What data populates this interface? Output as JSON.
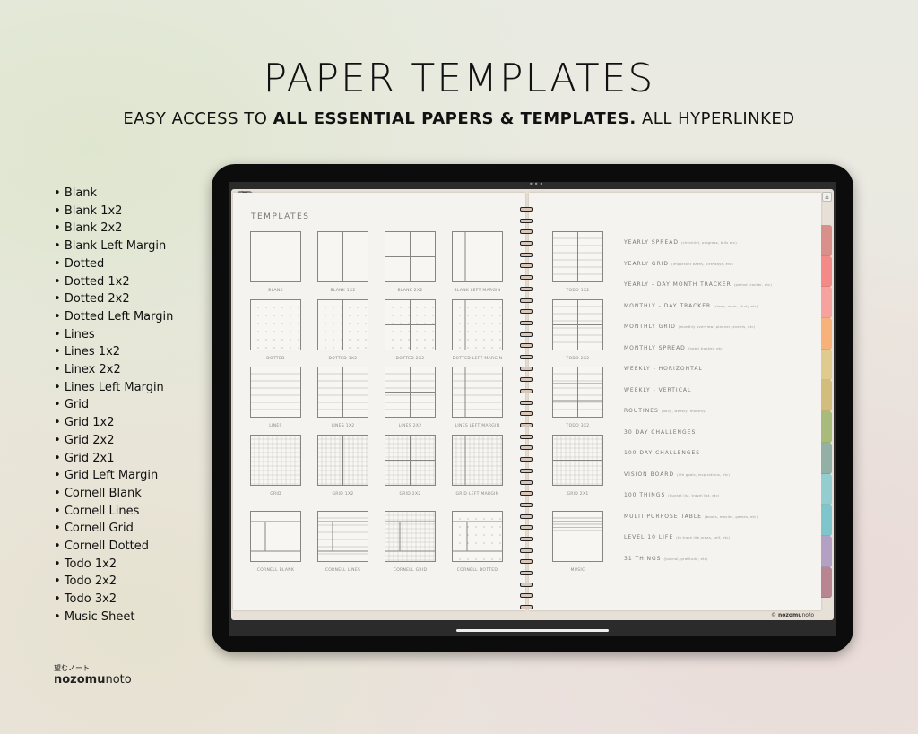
{
  "header": {
    "title": "PAPER TEMPLATES",
    "subtitle_pre": "EASY ACCESS TO ",
    "subtitle_bold": "ALL ESSENTIAL PAPERS & TEMPLATES.",
    "subtitle_post": " ALL HYPERLINKED"
  },
  "bullets": [
    "Blank",
    "Blank 1x2",
    "Blank 2x2",
    "Blank Left Margin",
    "Dotted",
    "Dotted 1x2",
    "Dotted 2x2",
    "Dotted Left Margin",
    "Lines",
    "Lines 1x2",
    "Linex 2x2",
    "Lines Left Margin",
    "Grid",
    "Grid 1x2",
    "Grid 2x2",
    "Grid 2x1",
    "Grid Left Margin",
    "Cornell Blank",
    "Cornell Lines",
    "Cornell Grid",
    "Cornell Dotted",
    "Todo 1x2",
    "Todo 2x2",
    "Todo 3x2",
    "Music Sheet"
  ],
  "brand": {
    "jp": "望むノート",
    "bold": "nozomu",
    "rest": "noto"
  },
  "notebook": {
    "collapse_icon": "chevron-down-icon",
    "menu_icon": "more-dots-icon",
    "home_icon": "home-icon",
    "page_title": "TEMPLATES",
    "copyright_pre": "© ",
    "copyright_bold": "nozomu",
    "copyright_rest": "noto",
    "left_templates": [
      {
        "label": "BLANK",
        "fill": "blank",
        "split": "none"
      },
      {
        "label": "BLANK 1X2",
        "fill": "blank",
        "split": "1x2"
      },
      {
        "label": "BLANK 2X2",
        "fill": "blank",
        "split": "2x2"
      },
      {
        "label": "BLANK LEFT MARGIN",
        "fill": "blank",
        "split": "margin"
      },
      {
        "label": "DOTTED",
        "fill": "dots",
        "split": "none"
      },
      {
        "label": "DOTTED 1X2",
        "fill": "dots",
        "split": "1x2"
      },
      {
        "label": "DOTTED 2X2",
        "fill": "dots",
        "split": "2x2"
      },
      {
        "label": "DOTTED LEFT MARGIN",
        "fill": "dots",
        "split": "margin"
      },
      {
        "label": "LINES",
        "fill": "lines",
        "split": "none"
      },
      {
        "label": "LINES 1X2",
        "fill": "lines",
        "split": "1x2"
      },
      {
        "label": "LINES 2X2",
        "fill": "lines",
        "split": "2x2"
      },
      {
        "label": "LINES LEFT MARGIN",
        "fill": "lines",
        "split": "margin"
      },
      {
        "label": "GRID",
        "fill": "grid",
        "split": "none"
      },
      {
        "label": "GRID 1X2",
        "fill": "grid",
        "split": "1x2"
      },
      {
        "label": "GRID 2X2",
        "fill": "grid",
        "split": "2x2"
      },
      {
        "label": "GRID LEFT MARGIN",
        "fill": "grid",
        "split": "margin"
      },
      {
        "label": "CORNELL BLANK",
        "fill": "blank",
        "split": "cornell"
      },
      {
        "label": "CORNELL LINES",
        "fill": "lines",
        "split": "cornell"
      },
      {
        "label": "CORNELL GRID",
        "fill": "grid",
        "split": "cornell"
      },
      {
        "label": "CORNELL DOTTED",
        "fill": "dots",
        "split": "cornell"
      }
    ],
    "right_templates": [
      {
        "label": "TODO 1X2",
        "fill": "lines",
        "split": "todo1"
      },
      {
        "label": "TODO 2X2",
        "fill": "lines",
        "split": "todo2"
      },
      {
        "label": "TODO 3X2",
        "fill": "lines",
        "split": "todo3"
      },
      {
        "label": "GRID 2X1",
        "fill": "grid",
        "split": "2x1"
      },
      {
        "label": "MUSIC",
        "fill": "music",
        "split": "none"
      }
    ],
    "sections": [
      {
        "label": "YEARLY SPREAD",
        "note": "(checklist, progress, bills etc)"
      },
      {
        "label": "YEARLY GRID",
        "note": "(important dates, birthdays, etc)"
      },
      {
        "label": "YEARLY - DAY MONTH TRACKER",
        "note": "(period tracker, etc)"
      },
      {
        "label": "MONTHLY - DAY TRACKER",
        "note": "(sleep, work, study etc)"
      },
      {
        "label": "MONTHLY GRID",
        "note": "(monthly overview, planner, events, etc)"
      },
      {
        "label": "MONTHLY SPREAD",
        "note": "(habit tracker, etc)"
      },
      {
        "label": "WEEKLY - HORIZONTAL",
        "note": ""
      },
      {
        "label": "WEEKLY - VERTICAL",
        "note": ""
      },
      {
        "label": "ROUTINES",
        "note": "(daily, weekly, monthly)"
      },
      {
        "label": "30 DAY CHALLENGES",
        "note": ""
      },
      {
        "label": "100 DAY CHALLENGES",
        "note": ""
      },
      {
        "label": "VISION BOARD",
        "note": "(life goals, inspirations, etc)"
      },
      {
        "label": "100 THINGS",
        "note": "(bucket list, travel list, etc)"
      },
      {
        "label": "MULTI PURPOSE TABLE",
        "note": "(books, movies, games, etc)"
      },
      {
        "label": "LEVEL 10 LIFE",
        "note": "(to track life areas, self, etc)"
      },
      {
        "label": "31 THINGS",
        "note": "(journal, gratitude, etc)"
      }
    ],
    "tab_colors": [
      "#d9908a",
      "#f48a87",
      "#f6a3a0",
      "#f7b27a",
      "#dfcb8e",
      "#d3bd7c",
      "#a8bb7a",
      "#93b0a6",
      "#94cdd0",
      "#7fc6cc",
      "#b4a0c3",
      "#b98590"
    ]
  }
}
